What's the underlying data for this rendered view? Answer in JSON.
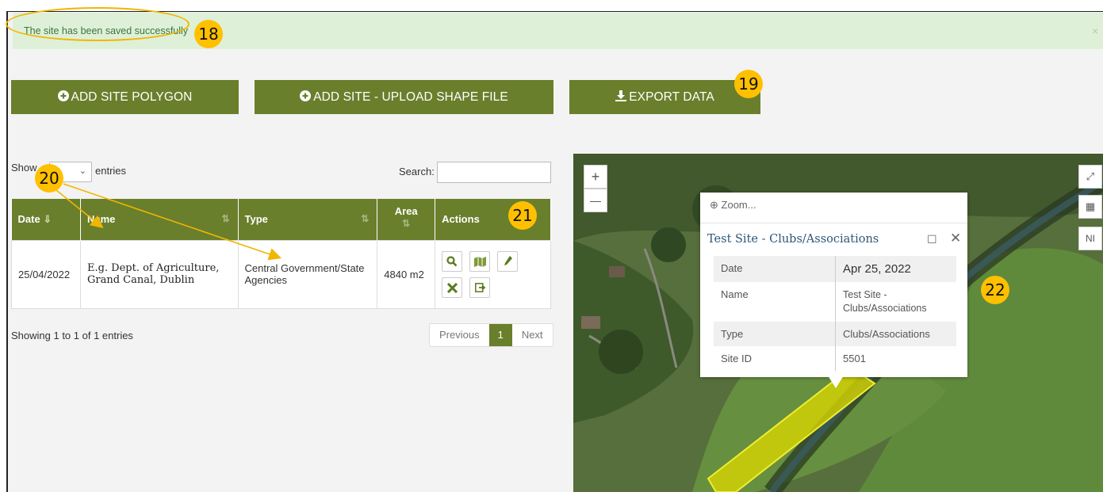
{
  "alert": {
    "message": "The site has been saved successfully",
    "close": "×"
  },
  "buttons": {
    "add_polygon": "ADD SITE POLYGON",
    "add_upload": "ADD SITE - UPLOAD SHAPE FILE",
    "export": "EXPORT DATA"
  },
  "table_controls": {
    "show_prefix": "Show",
    "entries": "entries",
    "search_label": "Search:"
  },
  "table": {
    "headers": [
      "Date",
      "Name",
      "Type",
      "Area",
      "Actions"
    ],
    "rows": [
      {
        "date": "25/04/2022",
        "name": "E.g. Dept. of Agriculture, Grand Canal, Dublin",
        "type": "Central Government/State Agencies",
        "area": "4840 m2"
      }
    ]
  },
  "footer": {
    "info": "Showing 1 to 1 of 1 entries",
    "prev": "Previous",
    "page": "1",
    "next": "Next"
  },
  "map": {
    "zoom_in": "+",
    "zoom_out": "—",
    "side_label": "NI",
    "popup": {
      "zoom": "Zoom...",
      "title": "Test Site - Clubs/Associations",
      "fields": [
        {
          "k": "Date",
          "v": "Apr 25, 2022"
        },
        {
          "k": "Name",
          "v": "Test Site - Clubs/Associations"
        },
        {
          "k": "Type",
          "v": "Clubs/Associations"
        },
        {
          "k": "Site ID",
          "v": "5501"
        }
      ]
    }
  },
  "annotations": {
    "b18": "18",
    "b19": "19",
    "b20": "20",
    "b21": "21",
    "b22": "22"
  },
  "colors": {
    "primary": "#6a7f2c",
    "badge": "#ffc000",
    "alert_bg": "#dff0d8",
    "polygon": "#d7d500"
  }
}
